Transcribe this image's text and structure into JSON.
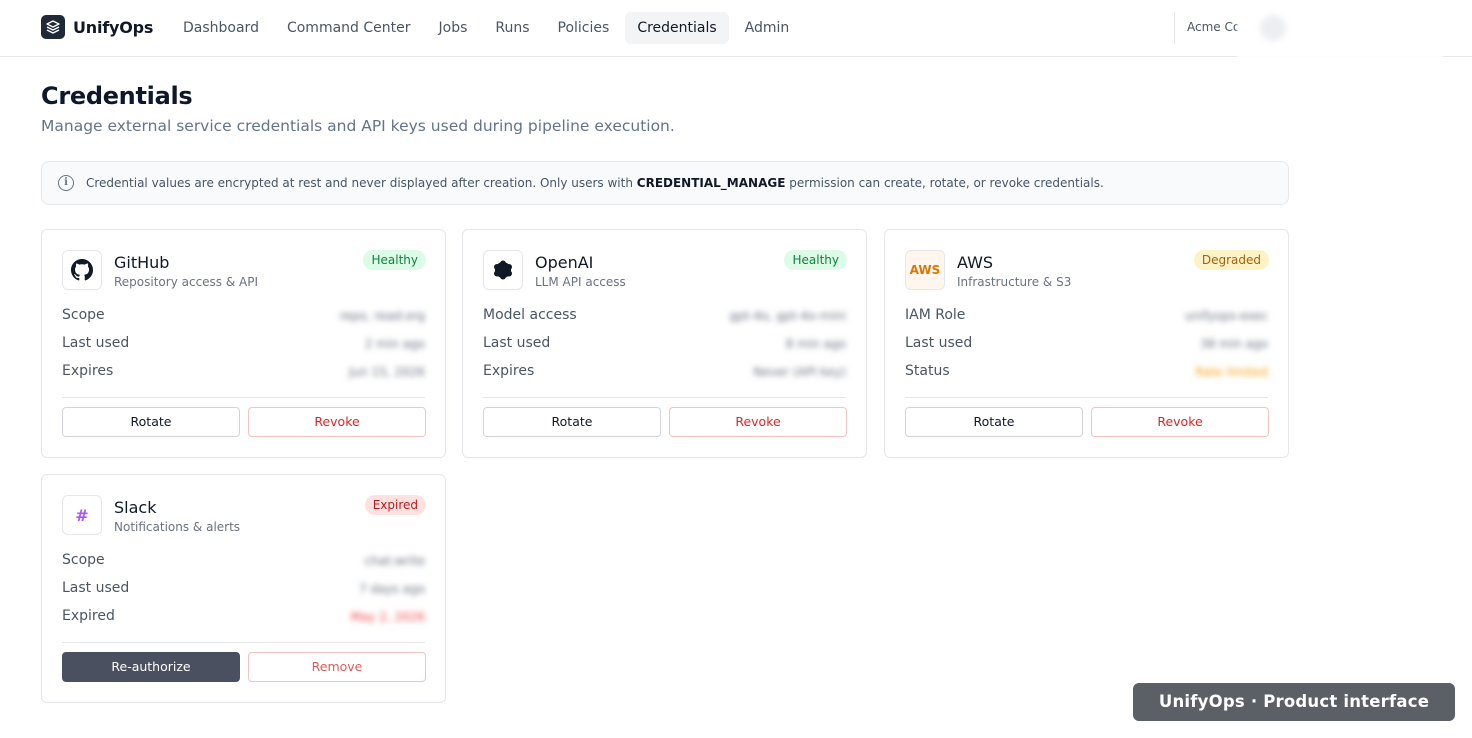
{
  "brand": {
    "name": "UnifyOps",
    "colors": {
      "primary": "#1f2937",
      "success": "#15803d",
      "warning": "#a16207",
      "danger": "#dc2626"
    }
  },
  "nav": {
    "items": [
      {
        "label": "Dashboard"
      },
      {
        "label": "Command Center"
      },
      {
        "label": "Jobs"
      },
      {
        "label": "Runs"
      },
      {
        "label": "Policies"
      },
      {
        "label": "Credentials",
        "active": true
      },
      {
        "label": "Admin"
      }
    ],
    "org": "Acme Co"
  },
  "page": {
    "title": "Credentials",
    "subtitle": "Manage external service credentials and API keys used during pipeline execution."
  },
  "banner": {
    "icon": "info-icon",
    "text_before": "Credential values are encrypted at rest and never displayed after creation. Only users with ",
    "permission": "CREDENTIAL_MANAGE",
    "text_after": " permission can create, rotate, or revoke credentials."
  },
  "cards": [
    {
      "name": "GitHub",
      "desc": "Repository access & API",
      "icon": "github-icon",
      "status": "Healthy",
      "rows": [
        {
          "label": "Scope",
          "value": "repo, read:org"
        },
        {
          "label": "Last used",
          "value": "2 min ago"
        },
        {
          "label": "Expires",
          "value": "Jun 15, 2026"
        }
      ],
      "actions": [
        "Rotate",
        "Revoke"
      ]
    },
    {
      "name": "OpenAI",
      "desc": "LLM API access",
      "icon": "openai-icon",
      "status": "Healthy",
      "rows": [
        {
          "label": "Model access",
          "value": "gpt-4o, gpt-4o-mini"
        },
        {
          "label": "Last used",
          "value": "8 min ago"
        },
        {
          "label": "Expires",
          "value": "Never (API key)"
        }
      ],
      "actions": [
        "Rotate",
        "Revoke"
      ]
    },
    {
      "name": "AWS",
      "desc": "Infrastructure & S3",
      "icon": "aws-icon",
      "icon_text": "AWS",
      "status": "Degraded",
      "rows": [
        {
          "label": "IAM Role",
          "value": "unifyops-exec"
        },
        {
          "label": "Last used",
          "value": "38 min ago"
        },
        {
          "label": "Status",
          "value": "Rate limited"
        }
      ],
      "actions": [
        "Rotate",
        "Revoke"
      ]
    },
    {
      "name": "Slack",
      "desc": "Notifications & alerts",
      "icon": "slack-hash-icon",
      "icon_text": "#",
      "status": "Expired",
      "rows": [
        {
          "label": "Scope",
          "value": "chat:write"
        },
        {
          "label": "Last used",
          "value": "7 days ago"
        },
        {
          "label": "Expired",
          "value": "May 2, 2026"
        }
      ],
      "actions": [
        "Re-authorize",
        "Remove"
      ]
    }
  ],
  "footer": {
    "tag": "UnifyOps · Product interface"
  }
}
